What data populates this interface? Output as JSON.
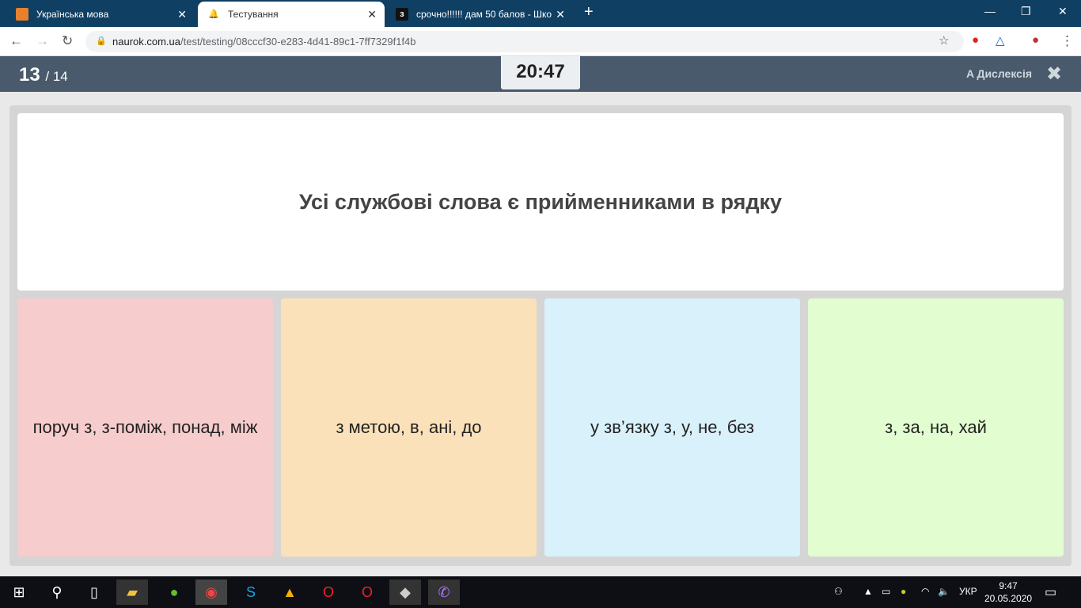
{
  "browser": {
    "tabs": [
      {
        "title": "Українська мова",
        "icon": "naurok-icon",
        "color": "#e8802c"
      },
      {
        "title": "Тестування",
        "icon": "bell-icon",
        "active": true
      },
      {
        "title": "срочно!!!!!! дам 50 балов - Шко",
        "icon": "znanija-icon"
      }
    ],
    "url_host": "naurok.com.ua",
    "url_path": "/test/testing/08cccf30-e283-4d41-89c1-7ff7329f1f4b"
  },
  "quiz": {
    "current": "13",
    "total": "/ 14",
    "timer": "20:47",
    "dyslexia_label": "A Дислексія",
    "question": "Усі службові слова є прийменниками в рядку",
    "options": [
      {
        "text": "поруч з, з-поміж, понад, між",
        "color": "#f6cccd"
      },
      {
        "text": "з метою, в, ані, до",
        "color": "#fae1b9"
      },
      {
        "text": "у зв’язку з, у, не, без",
        "color": "#d9f1fb"
      },
      {
        "text": "з, за, на, хай",
        "color": "#e2fdd0"
      }
    ]
  },
  "taskbar": {
    "lang": "УКР",
    "time": "9:47",
    "date": "20.05.2020"
  }
}
